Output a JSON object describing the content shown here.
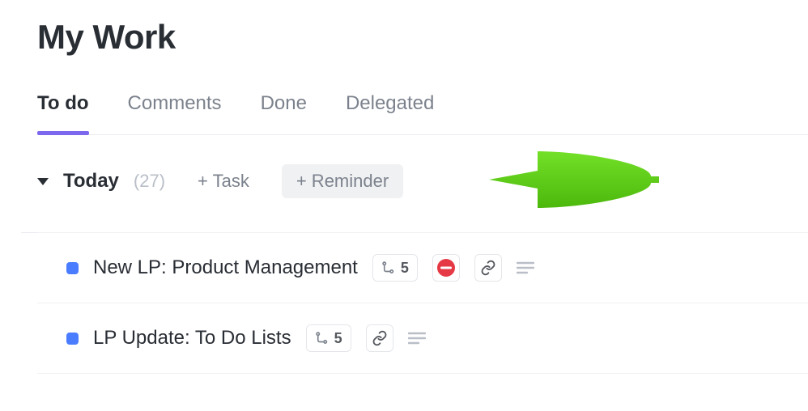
{
  "header": {
    "title": "My Work"
  },
  "tabs": [
    {
      "label": "To do",
      "active": true
    },
    {
      "label": "Comments",
      "active": false
    },
    {
      "label": "Done",
      "active": false
    },
    {
      "label": "Delegated",
      "active": false
    }
  ],
  "section": {
    "title": "Today",
    "count": "(27)",
    "add_task_label": "+ Task",
    "add_reminder_label": "+ Reminder"
  },
  "tasks": [
    {
      "title": "New LP: Product Management",
      "subtask_count": "5",
      "blocked": true,
      "has_link": true,
      "has_description": true
    },
    {
      "title": "LP Update: To Do Lists",
      "subtask_count": "5",
      "blocked": false,
      "has_link": true,
      "has_description": true
    }
  ],
  "colors": {
    "accent": "#7b68ee",
    "task_status": "#4a7cff",
    "blocked": "#e63946",
    "arrow": "#5fce1a"
  }
}
